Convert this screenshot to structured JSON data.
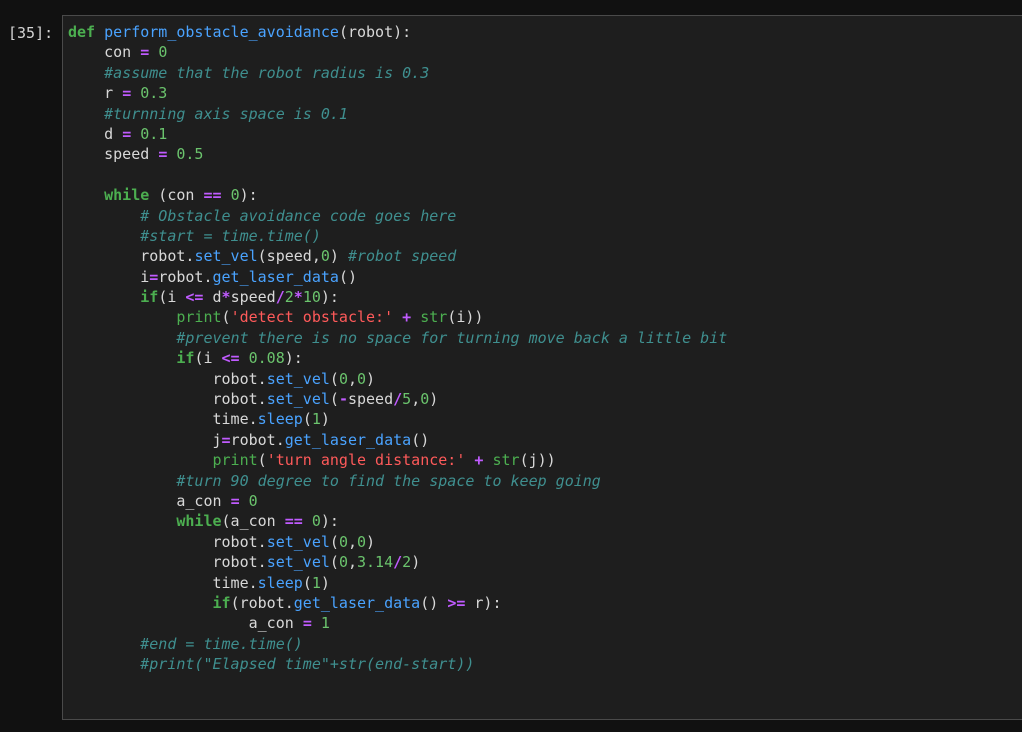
{
  "cell": {
    "prompt": "[35]:",
    "lines": [
      [
        {
          "t": "kw",
          "v": "def"
        },
        {
          "t": "plain",
          "v": " "
        },
        {
          "t": "fn",
          "v": "perform_obstacle_avoidance"
        },
        {
          "t": "plain",
          "v": "(robot):"
        }
      ],
      [
        {
          "t": "plain",
          "v": "    con "
        },
        {
          "t": "op",
          "v": "="
        },
        {
          "t": "plain",
          "v": " "
        },
        {
          "t": "num",
          "v": "0"
        }
      ],
      [
        {
          "t": "plain",
          "v": "    "
        },
        {
          "t": "cm",
          "v": "#assume that the robot radius is 0.3"
        }
      ],
      [
        {
          "t": "plain",
          "v": "    r "
        },
        {
          "t": "op",
          "v": "="
        },
        {
          "t": "plain",
          "v": " "
        },
        {
          "t": "num",
          "v": "0.3"
        }
      ],
      [
        {
          "t": "plain",
          "v": "    "
        },
        {
          "t": "cm",
          "v": "#turnning axis space is 0.1"
        }
      ],
      [
        {
          "t": "plain",
          "v": "    d "
        },
        {
          "t": "op",
          "v": "="
        },
        {
          "t": "plain",
          "v": " "
        },
        {
          "t": "num",
          "v": "0.1"
        }
      ],
      [
        {
          "t": "plain",
          "v": "    speed "
        },
        {
          "t": "op",
          "v": "="
        },
        {
          "t": "plain",
          "v": " "
        },
        {
          "t": "num",
          "v": "0.5"
        }
      ],
      [
        {
          "t": "plain",
          "v": ""
        }
      ],
      [
        {
          "t": "plain",
          "v": "    "
        },
        {
          "t": "kw",
          "v": "while"
        },
        {
          "t": "plain",
          "v": " (con "
        },
        {
          "t": "op",
          "v": "=="
        },
        {
          "t": "plain",
          "v": " "
        },
        {
          "t": "num",
          "v": "0"
        },
        {
          "t": "plain",
          "v": "):"
        }
      ],
      [
        {
          "t": "plain",
          "v": "        "
        },
        {
          "t": "cm",
          "v": "# Obstacle avoidance code goes here"
        }
      ],
      [
        {
          "t": "plain",
          "v": "        "
        },
        {
          "t": "cm",
          "v": "#start = time.time()"
        }
      ],
      [
        {
          "t": "plain",
          "v": "        robot."
        },
        {
          "t": "attr",
          "v": "set_vel"
        },
        {
          "t": "plain",
          "v": "(speed,"
        },
        {
          "t": "num",
          "v": "0"
        },
        {
          "t": "plain",
          "v": ") "
        },
        {
          "t": "cm",
          "v": "#robot speed"
        }
      ],
      [
        {
          "t": "plain",
          "v": "        i"
        },
        {
          "t": "op",
          "v": "="
        },
        {
          "t": "plain",
          "v": "robot."
        },
        {
          "t": "attr",
          "v": "get_laser_data"
        },
        {
          "t": "plain",
          "v": "()"
        }
      ],
      [
        {
          "t": "plain",
          "v": "        "
        },
        {
          "t": "kw",
          "v": "if"
        },
        {
          "t": "plain",
          "v": "(i "
        },
        {
          "t": "op",
          "v": "<="
        },
        {
          "t": "plain",
          "v": " d"
        },
        {
          "t": "op",
          "v": "*"
        },
        {
          "t": "plain",
          "v": "speed"
        },
        {
          "t": "op",
          "v": "/"
        },
        {
          "t": "num",
          "v": "2"
        },
        {
          "t": "op",
          "v": "*"
        },
        {
          "t": "num",
          "v": "10"
        },
        {
          "t": "plain",
          "v": "):"
        }
      ],
      [
        {
          "t": "plain",
          "v": "            "
        },
        {
          "t": "builtin",
          "v": "print"
        },
        {
          "t": "plain",
          "v": "("
        },
        {
          "t": "str",
          "v": "'detect obstacle:'"
        },
        {
          "t": "plain",
          "v": " "
        },
        {
          "t": "op",
          "v": "+"
        },
        {
          "t": "plain",
          "v": " "
        },
        {
          "t": "builtin",
          "v": "str"
        },
        {
          "t": "plain",
          "v": "(i))"
        }
      ],
      [
        {
          "t": "plain",
          "v": "            "
        },
        {
          "t": "cm",
          "v": "#prevent there is no space for turning move back a little bit"
        }
      ],
      [
        {
          "t": "plain",
          "v": "            "
        },
        {
          "t": "kw",
          "v": "if"
        },
        {
          "t": "plain",
          "v": "(i "
        },
        {
          "t": "op",
          "v": "<="
        },
        {
          "t": "plain",
          "v": " "
        },
        {
          "t": "num",
          "v": "0.08"
        },
        {
          "t": "plain",
          "v": "):"
        }
      ],
      [
        {
          "t": "plain",
          "v": "                robot."
        },
        {
          "t": "attr",
          "v": "set_vel"
        },
        {
          "t": "plain",
          "v": "("
        },
        {
          "t": "num",
          "v": "0"
        },
        {
          "t": "plain",
          "v": ","
        },
        {
          "t": "num",
          "v": "0"
        },
        {
          "t": "plain",
          "v": ")"
        }
      ],
      [
        {
          "t": "plain",
          "v": "                robot."
        },
        {
          "t": "attr",
          "v": "set_vel"
        },
        {
          "t": "plain",
          "v": "("
        },
        {
          "t": "op",
          "v": "-"
        },
        {
          "t": "plain",
          "v": "speed"
        },
        {
          "t": "op",
          "v": "/"
        },
        {
          "t": "num",
          "v": "5"
        },
        {
          "t": "plain",
          "v": ","
        },
        {
          "t": "num",
          "v": "0"
        },
        {
          "t": "plain",
          "v": ")"
        }
      ],
      [
        {
          "t": "plain",
          "v": "                time."
        },
        {
          "t": "attr",
          "v": "sleep"
        },
        {
          "t": "plain",
          "v": "("
        },
        {
          "t": "num",
          "v": "1"
        },
        {
          "t": "plain",
          "v": ")"
        }
      ],
      [
        {
          "t": "plain",
          "v": "                j"
        },
        {
          "t": "op",
          "v": "="
        },
        {
          "t": "plain",
          "v": "robot."
        },
        {
          "t": "attr",
          "v": "get_laser_data"
        },
        {
          "t": "plain",
          "v": "()"
        }
      ],
      [
        {
          "t": "plain",
          "v": "                "
        },
        {
          "t": "builtin",
          "v": "print"
        },
        {
          "t": "plain",
          "v": "("
        },
        {
          "t": "str",
          "v": "'turn angle distance:'"
        },
        {
          "t": "plain",
          "v": " "
        },
        {
          "t": "op",
          "v": "+"
        },
        {
          "t": "plain",
          "v": " "
        },
        {
          "t": "builtin",
          "v": "str"
        },
        {
          "t": "plain",
          "v": "(j))"
        }
      ],
      [
        {
          "t": "plain",
          "v": "            "
        },
        {
          "t": "cm",
          "v": "#turn 90 degree to find the space to keep going"
        }
      ],
      [
        {
          "t": "plain",
          "v": "            a_con "
        },
        {
          "t": "op",
          "v": "="
        },
        {
          "t": "plain",
          "v": " "
        },
        {
          "t": "num",
          "v": "0"
        }
      ],
      [
        {
          "t": "plain",
          "v": "            "
        },
        {
          "t": "kw",
          "v": "while"
        },
        {
          "t": "plain",
          "v": "(a_con "
        },
        {
          "t": "op",
          "v": "=="
        },
        {
          "t": "plain",
          "v": " "
        },
        {
          "t": "num",
          "v": "0"
        },
        {
          "t": "plain",
          "v": "):"
        }
      ],
      [
        {
          "t": "plain",
          "v": "                robot."
        },
        {
          "t": "attr",
          "v": "set_vel"
        },
        {
          "t": "plain",
          "v": "("
        },
        {
          "t": "num",
          "v": "0"
        },
        {
          "t": "plain",
          "v": ","
        },
        {
          "t": "num",
          "v": "0"
        },
        {
          "t": "plain",
          "v": ")"
        }
      ],
      [
        {
          "t": "plain",
          "v": "                robot."
        },
        {
          "t": "attr",
          "v": "set_vel"
        },
        {
          "t": "plain",
          "v": "("
        },
        {
          "t": "num",
          "v": "0"
        },
        {
          "t": "plain",
          "v": ","
        },
        {
          "t": "num",
          "v": "3.14"
        },
        {
          "t": "op",
          "v": "/"
        },
        {
          "t": "num",
          "v": "2"
        },
        {
          "t": "plain",
          "v": ")"
        }
      ],
      [
        {
          "t": "plain",
          "v": "                time."
        },
        {
          "t": "attr",
          "v": "sleep"
        },
        {
          "t": "plain",
          "v": "("
        },
        {
          "t": "num",
          "v": "1"
        },
        {
          "t": "plain",
          "v": ")"
        }
      ],
      [
        {
          "t": "plain",
          "v": "                "
        },
        {
          "t": "kw",
          "v": "if"
        },
        {
          "t": "plain",
          "v": "(robot."
        },
        {
          "t": "attr",
          "v": "get_laser_data"
        },
        {
          "t": "plain",
          "v": "() "
        },
        {
          "t": "op",
          "v": ">="
        },
        {
          "t": "plain",
          "v": " r):"
        }
      ],
      [
        {
          "t": "plain",
          "v": "                    a_con "
        },
        {
          "t": "op",
          "v": "="
        },
        {
          "t": "plain",
          "v": " "
        },
        {
          "t": "num",
          "v": "1"
        }
      ],
      [
        {
          "t": "plain",
          "v": "        "
        },
        {
          "t": "cm",
          "v": "#end = time.time()"
        }
      ],
      [
        {
          "t": "plain",
          "v": "        "
        },
        {
          "t": "cm",
          "v": "#print(\"Elapsed time\"+str(end-start))"
        }
      ]
    ]
  }
}
